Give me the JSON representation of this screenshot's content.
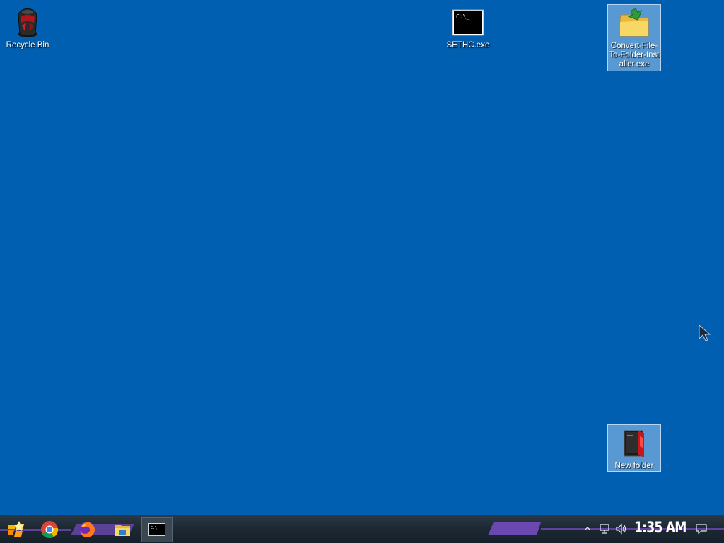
{
  "desktop": {
    "background_color": "#005fb0",
    "icons": [
      {
        "label": "Recycle Bin",
        "icon": "recycle-bin-icon"
      },
      {
        "label": "SETHC.exe",
        "icon": "console-exe-icon"
      },
      {
        "label": "Convert-File-To-Folder-Installer.exe",
        "icon": "folder-installer-icon"
      },
      {
        "label": "New folder",
        "icon": "folder-icon"
      }
    ]
  },
  "taskbar": {
    "accent_color": "#7e57c2",
    "start": {
      "icon": "start-logo-icon"
    },
    "pinned": [
      {
        "name": "Google Chrome",
        "icon": "chrome-icon"
      },
      {
        "name": "Firefox",
        "icon": "firefox-icon"
      },
      {
        "name": "File Explorer",
        "icon": "file-explorer-icon"
      },
      {
        "name": "SETHC.exe",
        "icon": "console-window-icon"
      }
    ],
    "tray": {
      "clock": "1:35 AM",
      "icons": [
        "chevron-up-icon",
        "network-icon",
        "volume-icon",
        "notification-icon"
      ]
    }
  }
}
